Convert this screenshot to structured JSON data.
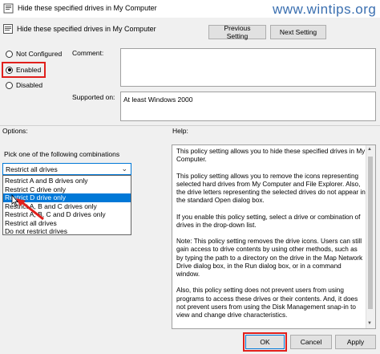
{
  "window": {
    "title": "Hide these specified drives in My Computer",
    "watermark": "www.wintips.org",
    "watermark_color": "#3a6fb0"
  },
  "header": {
    "title": "Hide these specified drives in My Computer",
    "previous_label": "Previous Setting",
    "next_label": "Next Setting"
  },
  "state": {
    "options": [
      {
        "label": "Not Configured",
        "checked": false
      },
      {
        "label": "Enabled",
        "checked": true
      },
      {
        "label": "Disabled",
        "checked": false
      }
    ]
  },
  "comment": {
    "label": "Comment:",
    "value": ""
  },
  "supported": {
    "label": "Supported on:",
    "value": "At least Windows 2000"
  },
  "options_label": "Options:",
  "help_label": "Help:",
  "options_panel": {
    "prompt": "Pick one of the following combinations",
    "selected": "Restrict all drives",
    "items": [
      {
        "label": "Restrict A and B drives only",
        "highlighted": false
      },
      {
        "label": "Restrict C drive only",
        "highlighted": false
      },
      {
        "label": "Restrict D drive only",
        "highlighted": true
      },
      {
        "label": "Restrict A, B and C drives only",
        "highlighted": false
      },
      {
        "label": "Restrict A, B, C and D drives only",
        "highlighted": false
      },
      {
        "label": "Restrict all drives",
        "highlighted": false
      },
      {
        "label": "Do not restrict drives",
        "highlighted": false
      }
    ]
  },
  "help": {
    "text": "This policy setting allows you to hide these specified drives in My Computer.\n\nThis policy setting allows you to remove the icons representing selected hard drives from My Computer and File Explorer. Also, the drive letters representing the selected drives do not appear in the standard Open dialog box.\n\nIf you enable this policy setting, select a drive or combination of drives in the drop-down list.\n\nNote: This policy setting removes the drive icons. Users can still gain access to drive contents by using other methods, such as by typing the path to a directory on the drive in the Map Network Drive dialog box, in the Run dialog box, or in a command window.\n\nAlso, this policy setting does not prevent users from using programs to access these drives or their contents. And, it does not prevent users from using the Disk Management snap-in to view and change drive characteristics."
  },
  "footer": {
    "ok_label": "OK",
    "cancel_label": "Cancel",
    "apply_label": "Apply"
  },
  "colors": {
    "highlight": "#e0201c",
    "selection": "#0078d7"
  }
}
